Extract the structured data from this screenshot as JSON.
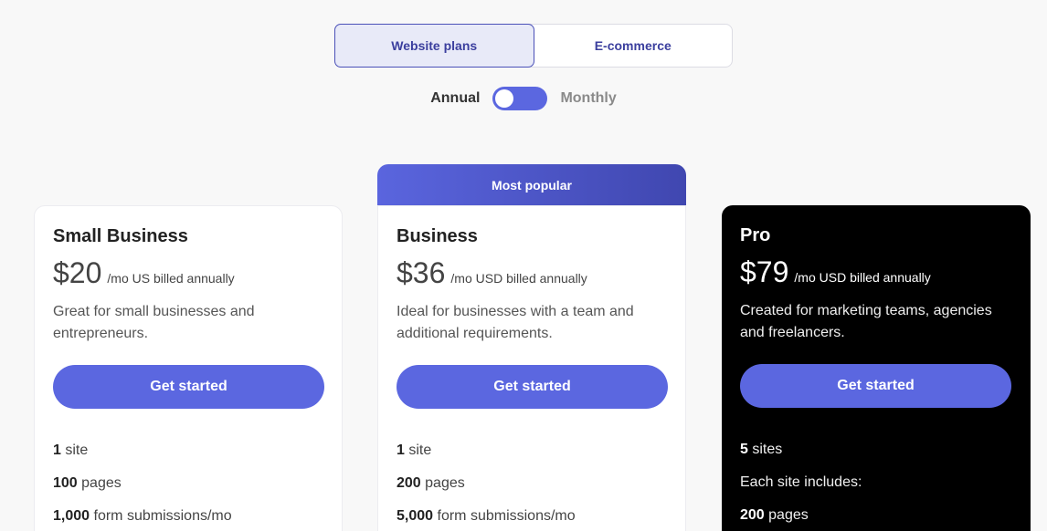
{
  "tabs": [
    {
      "label": "Website plans",
      "active": true
    },
    {
      "label": "E-commerce",
      "active": false
    }
  ],
  "billing": {
    "annual_label": "Annual",
    "monthly_label": "Monthly",
    "selected": "Annual"
  },
  "colors": {
    "accent": "#5b67e0",
    "dark_card": "#000000",
    "popular_gradient_start": "#5a65de",
    "popular_gradient_end": "#4047b0"
  },
  "plans": [
    {
      "name": "Small Business",
      "price": "$20",
      "price_note": "/mo US billed annually",
      "description": "Great for small businesses and entrepreneurs.",
      "cta": "Get started",
      "features": [
        {
          "strong": "1",
          "text": " site"
        },
        {
          "strong": "100",
          "text": " pages"
        },
        {
          "strong": "1,000",
          "text": " form submissions/mo"
        }
      ]
    },
    {
      "badge": "Most popular",
      "name": "Business",
      "price": "$36",
      "price_note": "/mo USD billed annually",
      "description": "Ideal for businesses with a team and additional requirements.",
      "cta": "Get started",
      "features": [
        {
          "strong": "1",
          "text": " site"
        },
        {
          "strong": "200",
          "text": " pages"
        },
        {
          "strong": "5,000",
          "text": " form submissions/mo"
        }
      ]
    },
    {
      "name": "Pro",
      "price": "$79",
      "price_note": "/mo USD billed annually",
      "description": "Created for marketing teams, agencies and freelancers.",
      "cta": "Get started",
      "features": [
        {
          "strong": "5",
          "text": " sites"
        },
        {
          "strong": "",
          "text": "Each site includes:"
        },
        {
          "strong": "200",
          "text": " pages"
        }
      ]
    }
  ]
}
